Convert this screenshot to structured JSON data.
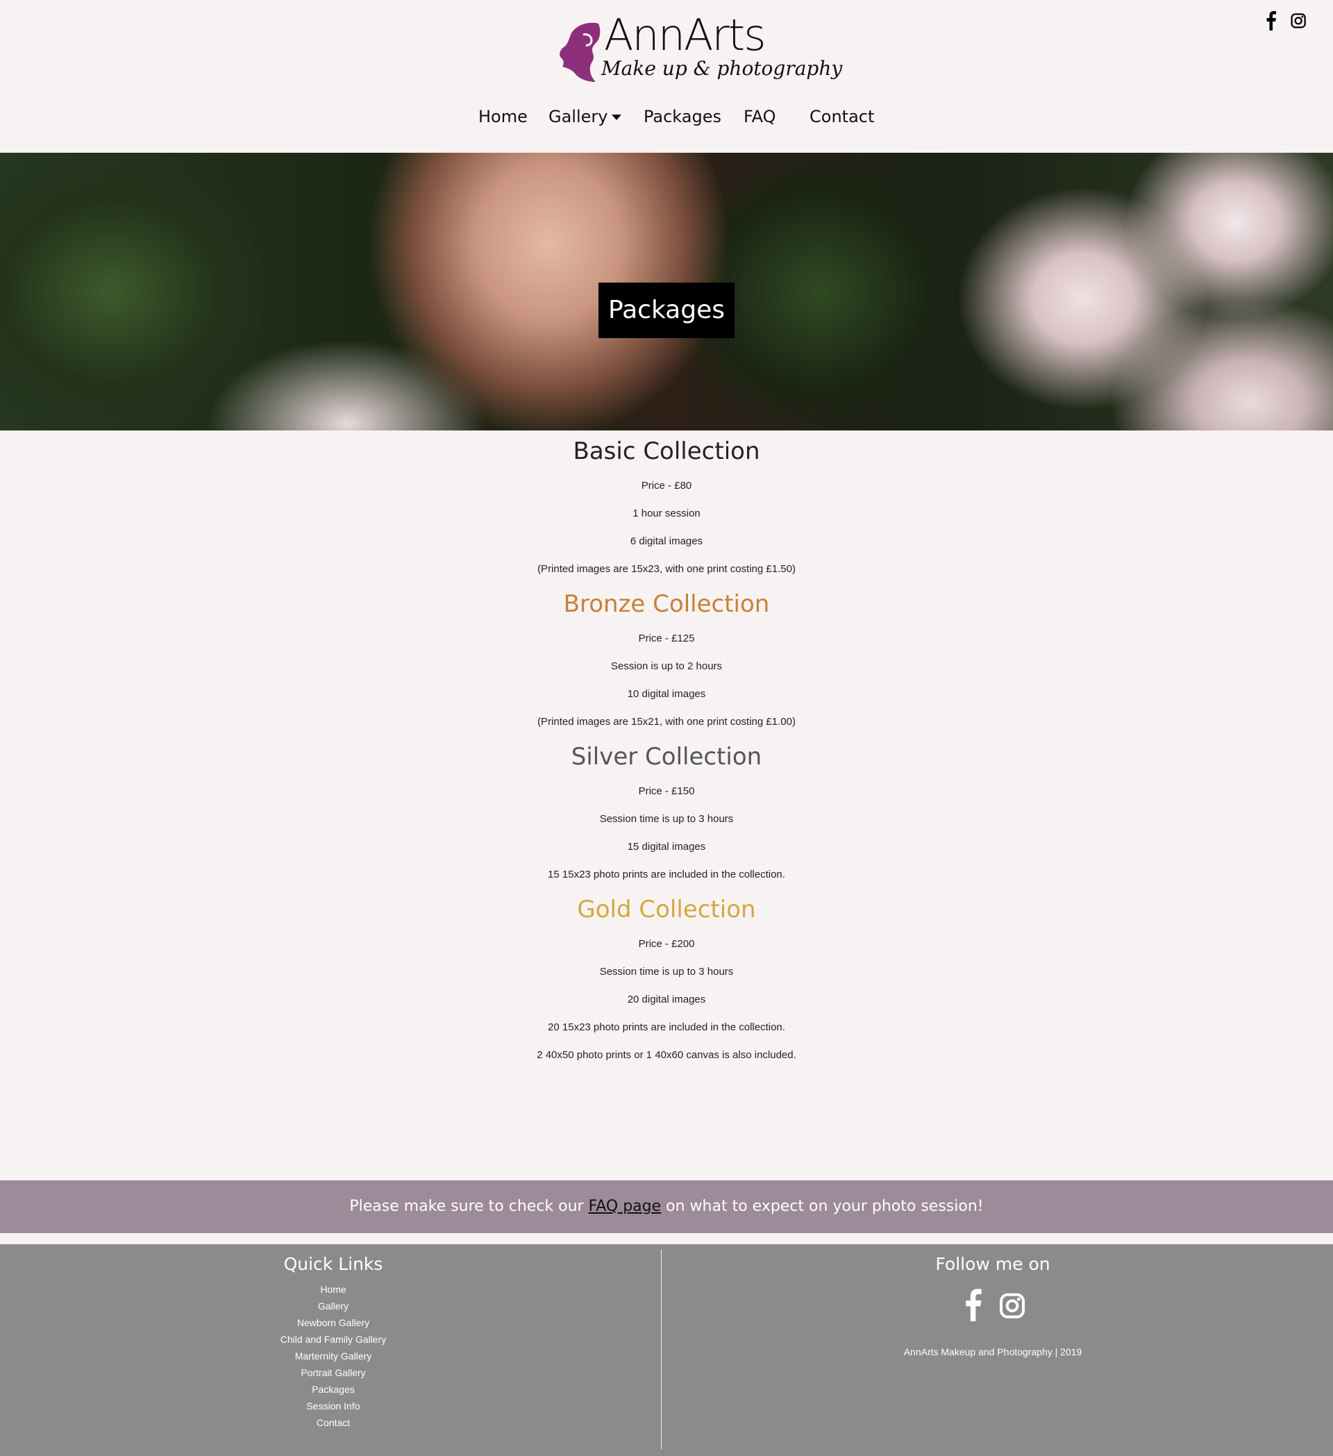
{
  "header": {
    "logo": {
      "brand": "AnnArts",
      "tagline": "Make up & photography"
    },
    "nav": [
      {
        "label": "Home"
      },
      {
        "label": "Gallery"
      },
      {
        "label": "Packages"
      },
      {
        "label": "FAQ"
      },
      {
        "label": "Contact"
      }
    ],
    "social": [
      "facebook-icon",
      "instagram-icon"
    ]
  },
  "hero": {
    "title": "Packages"
  },
  "collections": [
    {
      "title": "Basic Collection",
      "color": "#222222",
      "lines": [
        "Price - £80",
        "1 hour session",
        "6 digital images",
        "(Printed images are 15x23, with one print costing £1.50)"
      ]
    },
    {
      "title": "Bronze Collection",
      "color": "#c97f35",
      "lines": [
        "Price - £125",
        "Session is up to 2 hours",
        "10 digital images",
        "(Printed images are 15x21, with one print costing £1.00)"
      ]
    },
    {
      "title": "Silver Collection",
      "color": "#555555",
      "lines": [
        "Price - £150",
        "Session time is up to 3 hours",
        "15 digital images",
        "15 15x23 photo prints are included in the collection."
      ]
    },
    {
      "title": "Gold Collection",
      "color": "#d4a83e",
      "lines": [
        "Price - £200",
        "Session time is up to 3 hours",
        "20 digital images",
        "20 15x23 photo prints are included in the collection.",
        "2 40x50 photo prints or 1 40x60 canvas is also included."
      ]
    }
  ],
  "faq_band": {
    "before": "Please make sure to check our ",
    "link": "FAQ page",
    "after": " on what to expect on your photo session!"
  },
  "footer": {
    "quick_links_title": "Quick Links",
    "quick_links": [
      "Home",
      "Gallery",
      "Newborn Gallery",
      "Child and Family Gallery",
      "Marternity Gallery",
      "Portrait Gallery",
      "Packages",
      "Session Info",
      "Contact"
    ],
    "follow_title": "Follow me on",
    "copyright": "AnnArts Makeup and Photography | 2019"
  }
}
